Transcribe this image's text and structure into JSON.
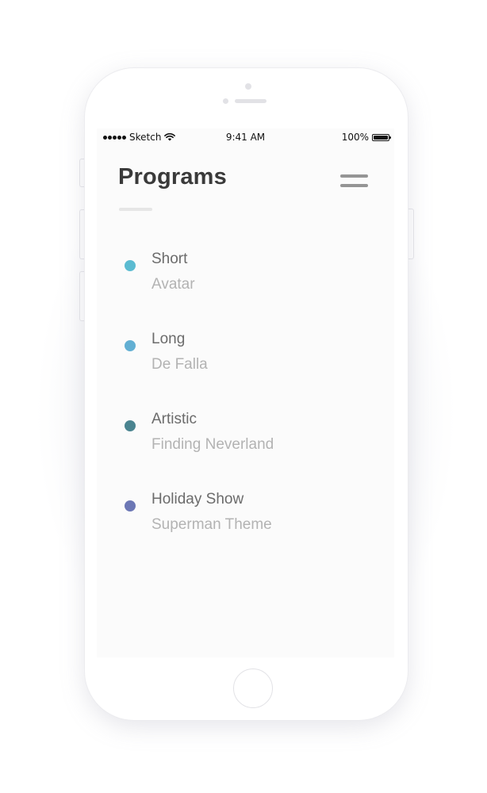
{
  "status_bar": {
    "carrier": "Sketch",
    "time": "9:41 AM",
    "battery": "100%"
  },
  "header": {
    "title": "Programs",
    "menu_icon": "hamburger-menu-icon"
  },
  "programs": [
    {
      "name": "Short",
      "music": "Avatar",
      "color": "#5BBBD1"
    },
    {
      "name": "Long",
      "music": "De Falla",
      "color": "#62AFD3"
    },
    {
      "name": "Artistic",
      "music": "Finding Neverland",
      "color": "#4A8490"
    },
    {
      "name": "Holiday Show",
      "music": "Superman Theme",
      "color": "#6C77B5"
    }
  ]
}
